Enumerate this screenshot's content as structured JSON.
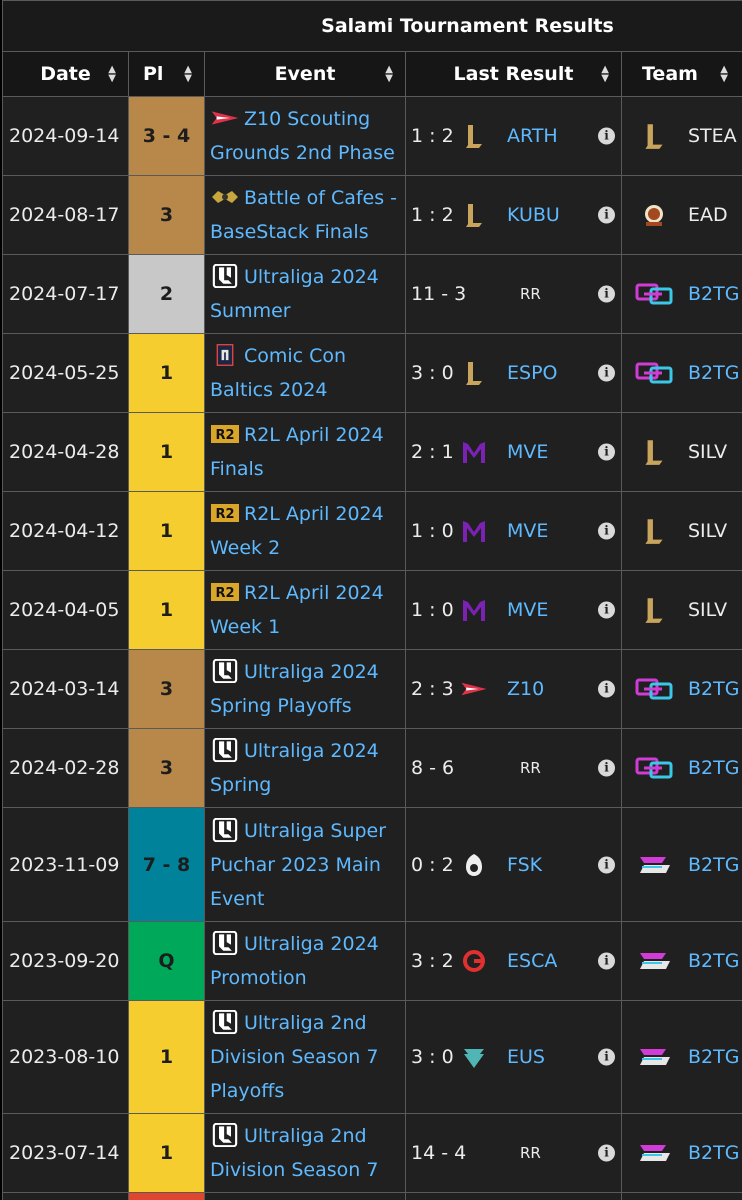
{
  "table": {
    "title": "Salami Tournament Results",
    "headers": {
      "date": "Date",
      "place": "Pl",
      "event": "Event",
      "last_result": "Last Result",
      "team": "Team"
    },
    "rows": [
      {
        "date": "2024-09-14",
        "place": "3 - 4",
        "place_color": "#b8874a",
        "event_icon": "z10-logo-icon",
        "event_l1": "Z10 Scouting",
        "event_l2": "Grounds 2nd Phase",
        "event_l3": "",
        "score": "1 : 2",
        "opp_logo": "lol-l-logo-icon",
        "opp": "ARTH",
        "team_logo": "lol-l-logo-icon",
        "team": "STEA",
        "team_link": false
      },
      {
        "date": "2024-08-17",
        "place": "3",
        "place_color": "#b8874a",
        "event_icon": "cafes-logo-icon",
        "event_l1": "Battle of Cafes -",
        "event_l2": "BaseStack Finals",
        "event_l3": "",
        "score": "1 : 2",
        "opp_logo": "lol-l-logo-icon",
        "opp": "KUBU",
        "team_logo": "ead-logo-icon",
        "team": "EAD",
        "team_link": false
      },
      {
        "date": "2024-07-17",
        "place": "2",
        "place_color": "#c8c8c8",
        "event_icon": "ultraliga-logo-icon",
        "event_l1": "Ultraliga 2024",
        "event_l2": "Summer",
        "event_l3": "",
        "score": "11 - 3",
        "opp_logo": "",
        "opp": "",
        "rr": "RR",
        "team_logo": "b2tg-logo-icon",
        "team": "B2TG",
        "team_link": true
      },
      {
        "date": "2024-05-25",
        "place": "1",
        "place_color": "#f6cd2e",
        "event_icon": "comic-con-logo-icon",
        "event_l1": "Comic Con",
        "event_l2": "Baltics 2024",
        "event_l3": "",
        "score": "3 : 0",
        "opp_logo": "lol-l-logo-icon",
        "opp": "ESPO",
        "team_logo": "b2tg-logo-icon",
        "team": "B2TG",
        "team_link": true
      },
      {
        "date": "2024-04-28",
        "place": "1",
        "place_color": "#f6cd2e",
        "event_icon": "r2l-logo-icon",
        "event_l1": "R2L April 2024",
        "event_l2": "Finals",
        "event_l3": "",
        "score": "2 : 1",
        "opp_logo": "mve-logo-icon",
        "opp": "MVE",
        "team_logo": "lol-l-logo-icon",
        "team": "SILV",
        "team_link": false
      },
      {
        "date": "2024-04-12",
        "place": "1",
        "place_color": "#f6cd2e",
        "event_icon": "r2l-logo-icon",
        "event_l1": "R2L April 2024",
        "event_l2": "Week 2",
        "event_l3": "",
        "score": "1 : 0",
        "opp_logo": "mve-logo-icon",
        "opp": "MVE",
        "team_logo": "lol-l-logo-icon",
        "team": "SILV",
        "team_link": false
      },
      {
        "date": "2024-04-05",
        "place": "1",
        "place_color": "#f6cd2e",
        "event_icon": "r2l-logo-icon",
        "event_l1": "R2L April 2024",
        "event_l2": "Week 1",
        "event_l3": "",
        "score": "1 : 0",
        "opp_logo": "mve-logo-icon",
        "opp": "MVE",
        "team_logo": "lol-l-logo-icon",
        "team": "SILV",
        "team_link": false
      },
      {
        "date": "2024-03-14",
        "place": "3",
        "place_color": "#b8874a",
        "event_icon": "ultraliga-logo-icon",
        "event_l1": "Ultraliga 2024",
        "event_l2": "Spring Playoffs",
        "event_l3": "",
        "score": "2 : 3",
        "opp_logo": "z10-logo-icon",
        "opp": "Z10",
        "team_logo": "b2tg-logo-icon",
        "team": "B2TG",
        "team_link": true
      },
      {
        "date": "2024-02-28",
        "place": "3",
        "place_color": "#b8874a",
        "event_icon": "ultraliga-logo-icon",
        "event_l1": "Ultraliga 2024",
        "event_l2": "Spring",
        "event_l3": "",
        "score": "8 - 6",
        "opp_logo": "",
        "opp": "",
        "rr": "RR",
        "team_logo": "b2tg-logo-icon",
        "team": "B2TG",
        "team_link": true
      },
      {
        "date": "2023-11-09",
        "place": "7 - 8",
        "place_color": "#00839a",
        "event_icon": "ultraliga-logo-icon",
        "event_l1": "Ultraliga Super",
        "event_l2": "Puchar 2023 Main",
        "event_l3": "Event",
        "score": "0 : 2",
        "opp_logo": "fsk-logo-icon",
        "opp": "FSK",
        "team_logo": "back2game-logo-icon",
        "team": "B2TG",
        "team_link": true
      },
      {
        "date": "2023-09-20",
        "place": "Q",
        "place_color": "#00a859",
        "event_icon": "ultraliga-logo-icon",
        "event_l1": "Ultraliga 2024",
        "event_l2": "Promotion",
        "event_l3": "",
        "score": "3 : 2",
        "opp_logo": "esca-logo-icon",
        "opp": "ESCA",
        "team_logo": "back2game-logo-icon",
        "team": "B2TG",
        "team_link": true
      },
      {
        "date": "2023-08-10",
        "place": "1",
        "place_color": "#f6cd2e",
        "event_icon": "ultraliga-logo-icon",
        "event_l1": "Ultraliga 2nd",
        "event_l2": "Division Season 7",
        "event_l3": "Playoffs",
        "score": "3 : 0",
        "opp_logo": "eus-logo-icon",
        "opp": "EUS",
        "team_logo": "back2game-logo-icon",
        "team": "B2TG",
        "team_link": true
      },
      {
        "date": "2023-07-14",
        "place": "1",
        "place_color": "#f6cd2e",
        "event_icon": "ultraliga-logo-icon",
        "event_l1": "Ultraliga 2nd",
        "event_l2": "Division Season 7",
        "event_l3": "",
        "score": "14 - 4",
        "opp_logo": "",
        "opp": "",
        "rr": "RR",
        "team_logo": "back2game-logo-icon",
        "team": "B2TG",
        "team_link": true
      },
      {
        "date": "",
        "place": "",
        "place_color": "#e0452f",
        "event_icon": "",
        "event_l1": "",
        "event_l2": "",
        "event_l3": "",
        "score": "",
        "opp_logo": "",
        "opp": "",
        "team_logo": "",
        "team": "",
        "team_link": false
      }
    ],
    "info_glyph": "i",
    "sort_up": "▲",
    "sort_down": "▼"
  }
}
